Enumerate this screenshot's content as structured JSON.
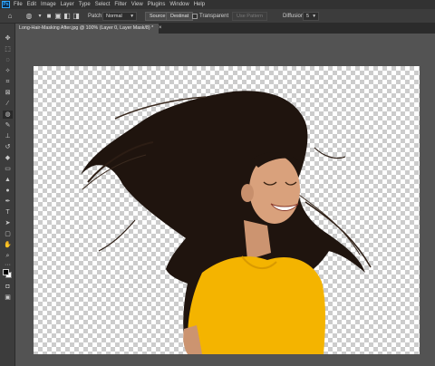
{
  "app": {
    "logo": "Ps"
  },
  "menu": [
    "File",
    "Edit",
    "Image",
    "Layer",
    "Type",
    "Select",
    "Filter",
    "View",
    "Plugins",
    "Window",
    "Help"
  ],
  "options": {
    "patch_label": "Patch:",
    "patch_mode": "Normal",
    "source_button": "Source",
    "destination_button": "Destinat",
    "transparent_label": "Transparent",
    "use_pattern_button": "Use Pattern",
    "diffusion_label": "Diffusion:",
    "diffusion_value": "5"
  },
  "document": {
    "tab_title": "Long-Hair-Masking After.jpg @ 100% (Layer 0, Layer Mask/8)",
    "tab_modified": "*",
    "tab_close": "×"
  },
  "icons": {
    "home": "home-icon",
    "tool_preset": "patch-tool-icon",
    "selection_modes": [
      "new-selection-icon",
      "add-selection-icon",
      "subtract-selection-icon",
      "intersect-selection-icon"
    ]
  },
  "tools": [
    "move",
    "marquee",
    "lasso",
    "magic-wand",
    "crop",
    "frame",
    "eyedropper",
    "healing",
    "brush",
    "clone-stamp",
    "history-brush",
    "eraser",
    "gradient",
    "blur",
    "dodge",
    "pen",
    "type",
    "path-selection",
    "rectangle",
    "hand",
    "zoom",
    "more"
  ],
  "colors": {
    "foreground": "#000000",
    "background": "#ffffff",
    "shirt": "#f4b400",
    "hair": "#1f140e",
    "skin": "#d9a17c"
  }
}
